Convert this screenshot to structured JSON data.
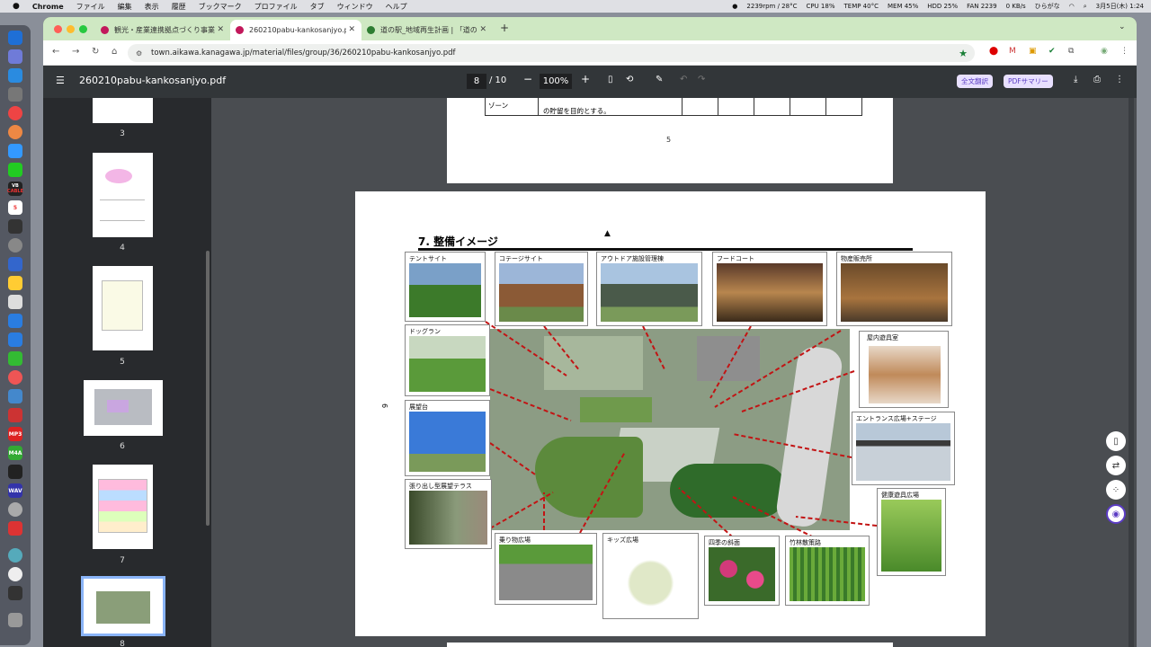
{
  "menubar": {
    "apple": "",
    "app": "Chrome",
    "items": [
      "ファイル",
      "編集",
      "表示",
      "履歴",
      "ブックマーク",
      "プロファイル",
      "タブ",
      "ウィンドウ",
      "ヘルプ"
    ],
    "status": {
      "fan_temp": "2239rpm / 28°C",
      "cpu": "CPU 18%",
      "temp": "TEMP 40°C",
      "mem": "MEM 45%",
      "hdd": "HDD 25%",
      "fan": "FAN 2239",
      "net": "0 KB/s",
      "ime": "ひらがな",
      "clock": "3月5日(木) 1:24"
    }
  },
  "tabs": [
    {
      "label": "観光・産業連携拠点づくり事業基本..."
    },
    {
      "label": "260210pabu-kankosanjyo.pdf"
    },
    {
      "label": "道の駅_地域再生計画 | 「道の駅..."
    }
  ],
  "address": {
    "url": "town.aikawa.kanagawa.jp/material/files/group/36/260210pabu-kankosanjyo.pdf"
  },
  "pdf": {
    "title": "260210pabu-kankosanjyo.pdf",
    "page_current": "8",
    "page_total": "/ 10",
    "zoom": "100%",
    "btn_translate": "全文翻訳",
    "btn_summary": "PDFサマリー"
  },
  "thumbnails": [
    {
      "num": "3"
    },
    {
      "num": "4"
    },
    {
      "num": "5"
    },
    {
      "num": "6"
    },
    {
      "num": "7"
    },
    {
      "num": "8"
    }
  ],
  "page7_tail": {
    "zone": "ゾーン",
    "text": "の貯留を目的とする。",
    "page_number": "5"
  },
  "page8": {
    "side_number": "6",
    "heading": "7. 整備イメージ",
    "labels": {
      "tent": "テントサイト",
      "cottage": "コテージサイト",
      "outdoor": "アウトドア施設管理棟",
      "food": "フードコート",
      "shop": "物産販売所",
      "dog": "ドッグラン",
      "indoor": "屋内遊具室",
      "tower": "展望台",
      "entrance": "エントランス広場+ステージ",
      "terrace": "張り出し型展望テラス",
      "health": "健康遊具広場",
      "ride": "乗り物広場",
      "kids": "キッズ広場",
      "slope": "四季の斜面",
      "bamboo": "竹林散策路"
    }
  },
  "dock_labels": {
    "vb": "VB",
    "cable": "CABLE",
    "mp3": "MP3",
    "m4a": "M4A",
    "wav": "WAV",
    "cal": "5"
  }
}
